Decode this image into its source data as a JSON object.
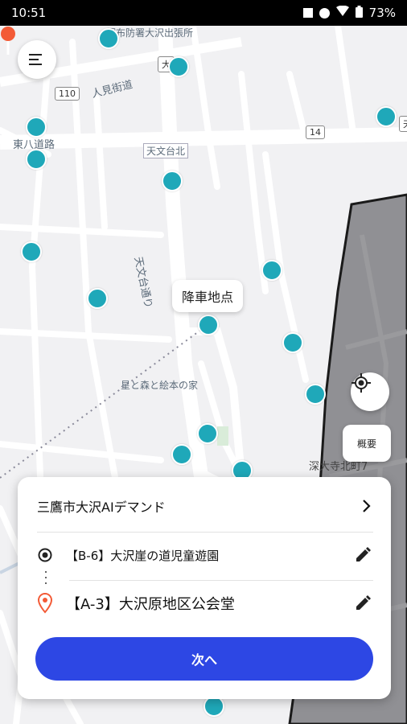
{
  "status_bar": {
    "time": "10:51",
    "battery": "73%"
  },
  "map": {
    "labels": {
      "fire_station": "調布防署大沢出張所",
      "street_jinken": "人見街道",
      "street_tohachi": "東八道路",
      "intersection": "天文台北",
      "street_tenmon": "天文台通り",
      "museum": "星と森と絵本の家",
      "district": "深大寺北町7",
      "shield_110": "110",
      "shield_14": "14",
      "shield_da": "大",
      "shield_ten": "天"
    },
    "callout": "降車地点",
    "overview_label": "概要"
  },
  "card": {
    "service_name": "三鷹市大沢AIデマンド",
    "origin": "【B-6】大沢崖の道児童遊園",
    "destination": "【A-3】大沢原地区公会堂",
    "next_button": "次へ"
  }
}
